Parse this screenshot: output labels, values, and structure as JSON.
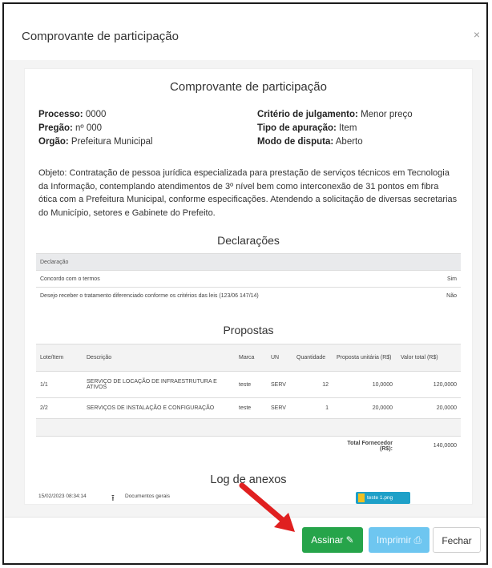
{
  "modal": {
    "title": "Comprovante de participação",
    "close": "×"
  },
  "doc": {
    "title": "Comprovante de participação",
    "processo_label": "Processo:",
    "processo": "0000",
    "pregao_label": "Pregão:",
    "pregao": "nº 000",
    "orgao_label": "Orgão:",
    "orgao": "Prefeitura Municipal",
    "criterio_label": "Critério de julgamento:",
    "criterio": "Menor preço",
    "tipo_label": "Tipo de apuração:",
    "tipo": "Item",
    "modo_label": "Modo de disputa:",
    "modo": "Aberto",
    "objeto": "Objeto: Contratação de pessoa jurídica especializada para prestação de serviços técnicos em Tecnologia da Informação, contemplando atendimentos de 3º nível bem como interconexão de 31 pontos em fibra ótica com a Prefeitura Municipal, conforme especificações. Atendendo a solicitação de diversas secretarias do Município, setores e Gabinete do Prefeito."
  },
  "declaracoes": {
    "title": "Declarações",
    "header": "Declaração",
    "rows": [
      {
        "text": "Concordo com o termos",
        "value": "Sim"
      },
      {
        "text": "Desejo receber o tratamento diferenciado conforme os critérios das leis (123/06 147/14)",
        "value": "Não"
      }
    ]
  },
  "propostas": {
    "title": "Propostas",
    "headers": {
      "lote": "Lote/Item",
      "descricao": "Descrição",
      "marca": "Marca",
      "un": "UN",
      "quantidade": "Quantidade",
      "unit": "Proposta unitária (R$)",
      "total": "Valor total (R$)"
    },
    "rows": [
      {
        "lote": "1/1",
        "descricao": "SERVIÇO DE LOCAÇÃO DE INFRAESTRUTURA E ATIVOS",
        "marca": "teste",
        "un": "SERV",
        "quantidade": "12",
        "unit": "10,0000",
        "total": "120,0000"
      },
      {
        "lote": "2/2",
        "descricao": "SERVIÇOS DE INSTALAÇÃO E CONFIGURAÇÃO",
        "marca": "teste",
        "un": "SERV",
        "quantidade": "1",
        "unit": "20,0000",
        "total": "20,0000"
      }
    ],
    "total_label": "Total Fornecedor (R$):",
    "total_value": "140,0000"
  },
  "anexos": {
    "title": "Log de anexos",
    "date": "15/02/2023 08:34:14",
    "category": "Documentos gerais",
    "file": "teste 1.png"
  },
  "footer": {
    "assinar": "Assinar",
    "imprimir": "Imprimir",
    "fechar": "Fechar"
  },
  "colors": {
    "assinar": "#26a44a",
    "imprimir": "#6ec6f0",
    "arrow": "#e02020",
    "file_badge": "#1ea0c8"
  }
}
